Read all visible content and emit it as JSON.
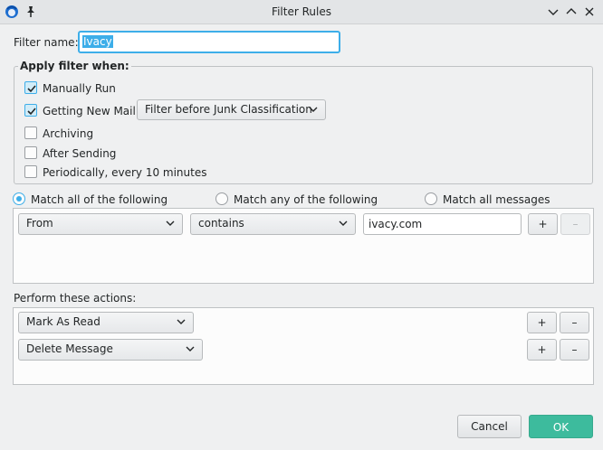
{
  "window": {
    "title": "Filter Rules",
    "close_icon": "x-icon",
    "maximize_icon": "chevron-up-icon",
    "minimize_icon": "chevron-down-icon"
  },
  "filter_name": {
    "label": "Filter name:",
    "value": "Ivacy"
  },
  "apply_when": {
    "title": "Apply filter when:",
    "manually_run": {
      "label": "Manually Run",
      "checked": true
    },
    "new_mail": {
      "label": "Getting New Mail:",
      "checked": true,
      "option": "Filter before Junk Classification"
    },
    "archiving": {
      "label": "Archiving",
      "checked": false
    },
    "after_sending": {
      "label": "After Sending",
      "checked": false
    },
    "periodically": {
      "label": "Periodically, every 10 minutes",
      "checked": false
    }
  },
  "match": {
    "all": "Match all of the following",
    "any": "Match any of the following",
    "all_messages": "Match all messages",
    "selected": "all"
  },
  "rules": [
    {
      "field": "From",
      "operator": "contains",
      "value": "ivacy.com",
      "add": "+",
      "remove": "–"
    }
  ],
  "actions": {
    "label": "Perform these actions:",
    "items": [
      {
        "action": "Mark As Read",
        "add": "+",
        "remove": "–"
      },
      {
        "action": "Delete Message",
        "add": "+",
        "remove": "–"
      }
    ]
  },
  "footer": {
    "cancel": "Cancel",
    "ok": "OK"
  },
  "colors": {
    "accent": "#3daee9",
    "ok": "#3dbb9d"
  }
}
